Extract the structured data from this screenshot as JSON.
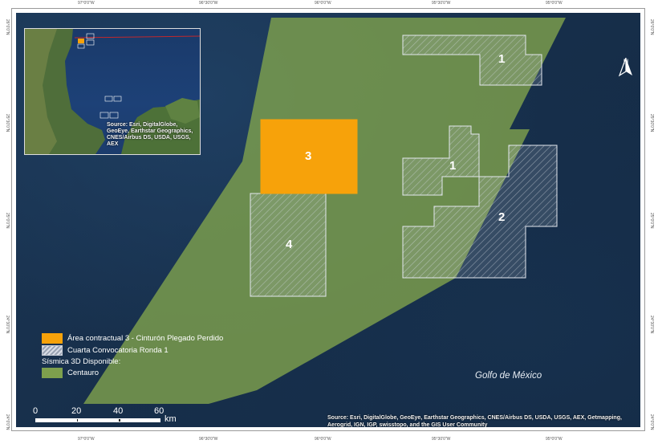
{
  "map": {
    "top_ticks": [
      "97°0'0\"W",
      "96°30'0\"W",
      "96°0'0\"W",
      "95°30'0\"W",
      "95°0'0\"W"
    ],
    "bottom_ticks": [
      "97°0'0\"W",
      "96°30'0\"W",
      "96°0'0\"W",
      "95°30'0\"W",
      "95°0'0\"W"
    ],
    "left_ticks": [
      "26°0'0\"N",
      "25°30'0\"N",
      "25°0'0\"N",
      "24°30'0\"N",
      "24°0'0\"N"
    ],
    "right_ticks": [
      "26°0'0\"N",
      "25°30'0\"N",
      "25°0'0\"N",
      "24°30'0\"N",
      "24°0'0\"N"
    ],
    "area_labels": {
      "block3": "3",
      "block4": "4",
      "block1_north": "1",
      "block1_mid": "1",
      "block2": "2"
    },
    "water_label": "Golfo de México",
    "attribution": "Source: Esri, DigitalGlobe, GeoEye, Earthstar Geographics, CNES/Airbus DS, USDA, USGS, AEX, Getmapping, Aerogrid, IGN, IGP, swisstopo, and the GIS User Community",
    "north_label": "N",
    "colors": {
      "contract_area": "#f7a20a",
      "seismic_centauro": "#7ea04d",
      "round_hatch": "#c9ced8"
    }
  },
  "inset": {
    "attribution": "Source: Esri, DigitalGlobe, GeoEye, Earthstar Geographics, CNES/Airbus DS, USDA, USGS, AEX"
  },
  "legend": {
    "item_contract": "Área contractual 3 - Cinturón Plegado Perdido",
    "item_round": "Cuarta Convocatoria Ronda 1",
    "heading_seismic": "Sísmica 3D Disponible:",
    "item_centauro": "Centauro"
  },
  "scale": {
    "labels": [
      "0",
      "20",
      "40",
      "60"
    ],
    "unit": "km"
  }
}
